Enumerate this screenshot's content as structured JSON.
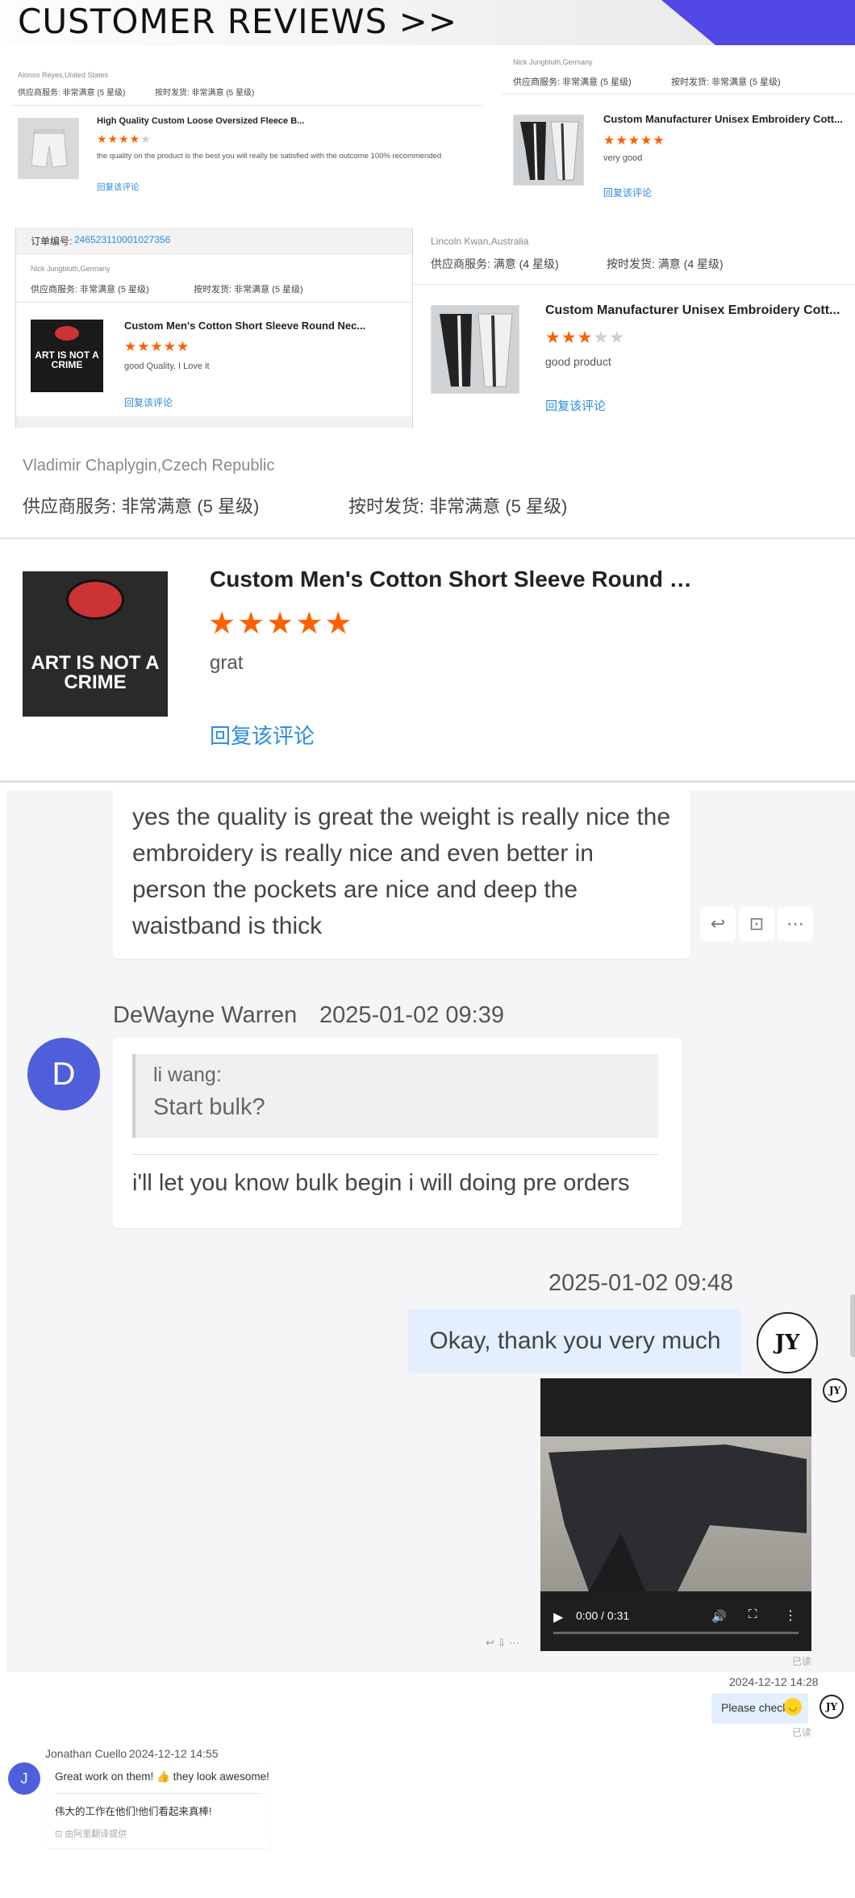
{
  "header": {
    "title": "CUSTOMER REVIEWS >>"
  },
  "review1": {
    "author": "Alonso Reyes,United States",
    "supplier_service": "供应商服务: 非常满意 (5 星级)",
    "on_time": "按时发货: 非常满意 (5 星级)",
    "product": "High Quality Custom Loose Oversized Fleece B...",
    "rating": 4,
    "comment": "the quality on the product is the best you will really be satisfied with the outcome 100% recommended",
    "reply": "回复该评论"
  },
  "review2": {
    "author": "Nick Jungbluth,Germany",
    "supplier_service": "供应商服务: 非常满意 (5 星级)",
    "on_time": "按时发货: 非常满意 (5 星级)",
    "product": "Custom Manufacturer Unisex Embroidery Cott...",
    "rating": 5,
    "comment": "very good",
    "reply": "回复该评论"
  },
  "review3": {
    "order_label": "订单编号:",
    "order_no": "246523110001027356",
    "author": "Nick Jungbluth,Germany",
    "supplier_service": "供应商服务: 非常满意 (5 星级)",
    "on_time": "按时发货: 非常满意 (5 星级)",
    "product": "Custom Men's Cotton Short Sleeve Round Nec...",
    "rating": 5,
    "comment": "good Quality. I Love it",
    "reply": "回复该评论",
    "shirt_text": "ART IS NOT A CRIME"
  },
  "review4": {
    "author": "Lincoln Kwan,Australia",
    "supplier_service": "供应商服务: 满意 (4 星级)",
    "on_time": "按时发货: 满意 (4 星级)",
    "product": "Custom Manufacturer Unisex Embroidery Cott...",
    "rating": 3,
    "comment": "good product",
    "reply": "回复该评论"
  },
  "review5": {
    "author": "Vladimir Chaplygin,Czech Republic",
    "supplier_service": "供应商服务: 非常满意 (5 星级)",
    "on_time": "按时发货: 非常满意 (5 星级)",
    "product": "Custom Men's Cotton Short Sleeve Round Nec...",
    "rating": 5,
    "comment": "grat",
    "reply": "回复该评论",
    "shirt_text": "ART IS NOT A CRIME"
  },
  "chat1": {
    "message": "yes the quality is great the weight is really nice the embroidery is really nice and even better in person the pockets are nice and deep the waistband is thick",
    "sender": "DeWayne Warren",
    "time": "2025-01-02 09:39",
    "avatar": "D",
    "quote_name": "li wang:",
    "quote_text": "Start bulk?",
    "reply": "i'll let you know bulk begin i will doing pre orders",
    "my_time": "2025-01-02 09:48",
    "my_message": "Okay, thank you very much",
    "logo": "JY"
  },
  "video": {
    "time": "0:00 / 0:31",
    "read": "已读"
  },
  "chat2": {
    "my_time": "2024-12-12 14:28",
    "my_message": "Please check",
    "read": "已读",
    "sender": "Jonathan Cuello",
    "time": "2024-12-12 14:55",
    "avatar": "J",
    "message": "Great work on them! 👍 they look awesome!",
    "translation": "伟大的工作在他们!他们看起来真棒!",
    "translation_source": "由阿里翻译提供"
  },
  "colors": {
    "accent": "#5148e6",
    "star": "#ff5f00",
    "link": "#2a8be0",
    "avatar": "#4f5fdc"
  }
}
